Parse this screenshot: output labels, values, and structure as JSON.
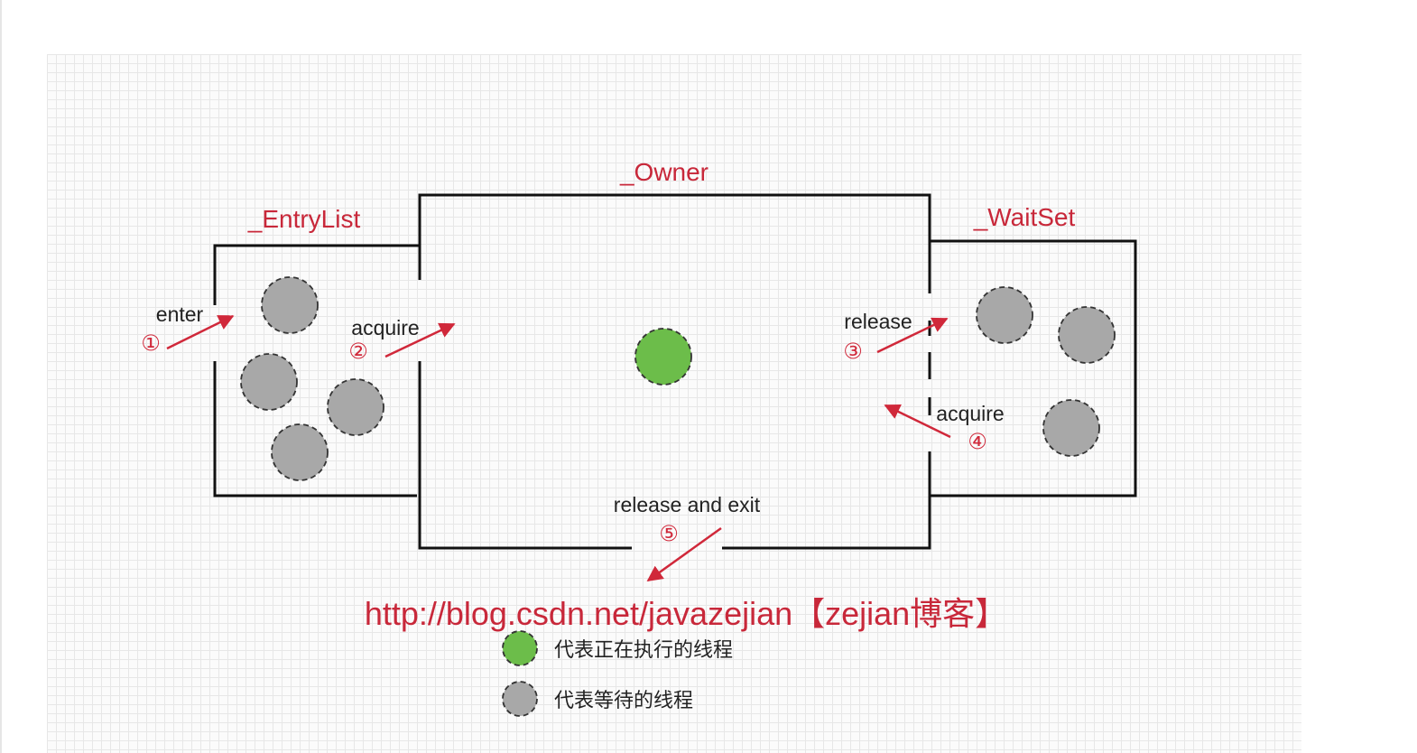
{
  "regions": {
    "entry_list": "_EntryList",
    "owner": "_Owner",
    "wait_set": "_WaitSet"
  },
  "steps": [
    {
      "num": "①",
      "label": "enter"
    },
    {
      "num": "②",
      "label": "acquire"
    },
    {
      "num": "③",
      "label": "release"
    },
    {
      "num": "④",
      "label": "acquire"
    },
    {
      "num": "⑤",
      "label": "release and exit"
    }
  ],
  "watermark": "http://blog.csdn.net/javazejian【zejian博客】",
  "legend": {
    "running": "代表正在执行的线程",
    "waiting": "代表等待的线程"
  },
  "colors": {
    "accent": "#c8283a",
    "running_thread": "#6cbd4a",
    "waiting_thread": "#a8a8a8",
    "border": "#111111"
  }
}
